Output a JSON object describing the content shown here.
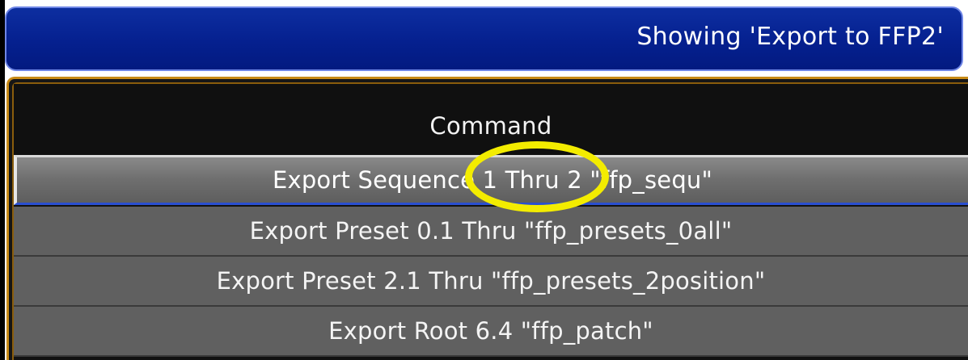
{
  "header": {
    "title": "Showing 'Export to FFP2'"
  },
  "table": {
    "column_header": "Command",
    "rows": [
      {
        "label": "Export Sequence 1 Thru 2 \"ffp_sequ\""
      },
      {
        "label": "Export Preset 0.1 Thru \"ffp_presets_0all\""
      },
      {
        "label": "Export Preset 2.1 Thru \"ffp_presets_2position\""
      },
      {
        "label": "Export Root 6.4 \"ffp_patch\""
      }
    ]
  },
  "colors": {
    "header_blue": "#05208f",
    "window_border": "#c88a16",
    "row_background": "#606060",
    "highlight_annotation": "#f3ec00"
  }
}
